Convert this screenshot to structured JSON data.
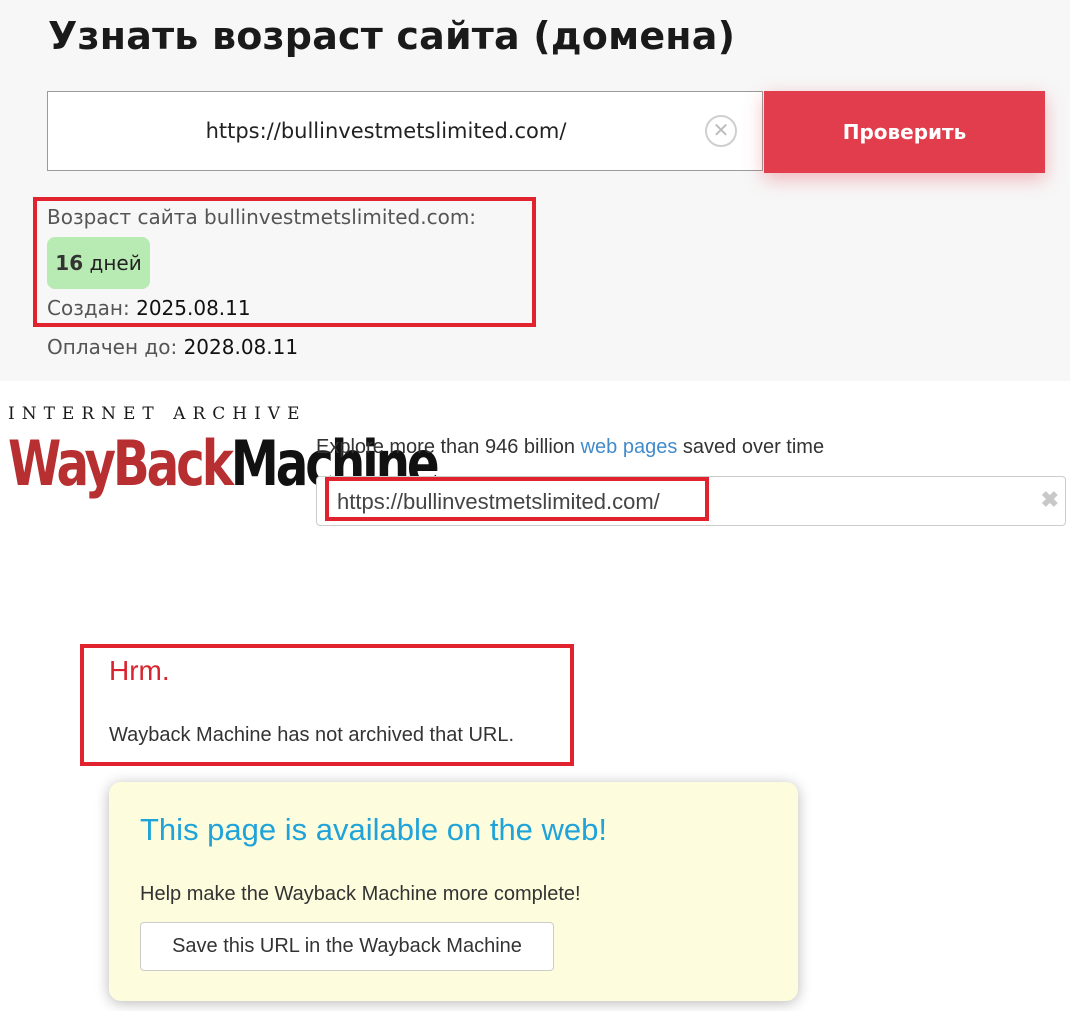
{
  "checker": {
    "title": "Узнать возраст сайта (домена)",
    "url_value": "https://bullinvestmetslimited.com/",
    "clear_symbol": "✕",
    "check_button": "Проверить",
    "age_label": "Возраст сайта bullinvestmetslimited.com:",
    "age_number": "16",
    "age_unit": "дней",
    "created_label": "Создан:",
    "created_value": "2025.08.11",
    "paid_label": "Оплачен до:",
    "paid_value": "2028.08.11"
  },
  "wayback": {
    "logo_top": "INTERNET ARCHIVE",
    "logo_word_a": "WayBack",
    "logo_word_b": "Machine",
    "explore_prefix": "Explore more than 946 billion ",
    "explore_link": "web pages",
    "explore_suffix": " saved over time",
    "search_value": "https://bullinvestmetslimited.com/",
    "clear_symbol": "✖",
    "hrm": "Hrm.",
    "not_archived": "Wayback Machine has not archived that URL.",
    "available_title": "This page is available on the web!",
    "help_text": "Help make the Wayback Machine more complete!",
    "save_button": "Save this URL in the Wayback Machine"
  },
  "colors": {
    "accent_red": "#e13d4c",
    "highlight_red": "#e0232e",
    "badge_green": "#b8ebb4",
    "link_blue": "#428bca",
    "available_blue": "#1fa3d9",
    "card_yellow": "#fdfcdc"
  },
  "icons": {
    "clear": "circle-x-icon",
    "search_clear": "x-icon"
  }
}
